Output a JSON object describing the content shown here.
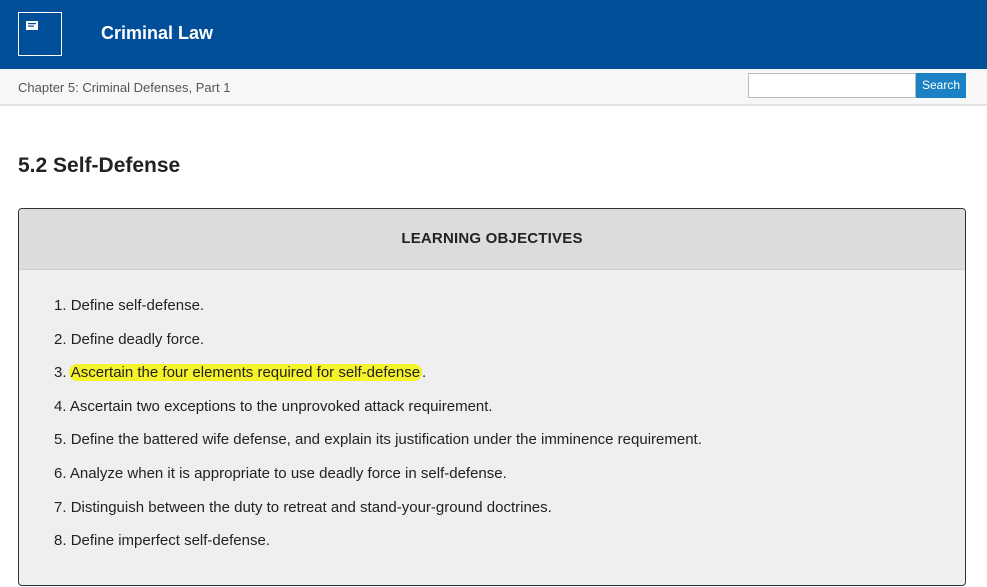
{
  "header": {
    "book_title": "Criminal Law",
    "logo_icon": "book-logo-icon",
    "background_color": "#004f98"
  },
  "subheader": {
    "chapter_title": "Chapter 5: Criminal Defenses, Part 1",
    "search": {
      "placeholder": "",
      "button_label": "Search",
      "button_color": "#1a82c4"
    }
  },
  "main": {
    "section_title": "5.2 Self-Defense",
    "objectives": {
      "heading": "LEARNING OBJECTIVES",
      "highlight_color": "#f5f32a",
      "items": [
        {
          "number": "1.",
          "text": "Define self-defense.",
          "highlighted": false
        },
        {
          "number": "2.",
          "text": "Define deadly force.",
          "highlighted": false
        },
        {
          "number": "3.",
          "text": "Ascertain the four elements required for self-defense",
          "suffix": ".",
          "highlighted": true
        },
        {
          "number": "4.",
          "text": "Ascertain two exceptions to the unprovoked attack requirement.",
          "highlighted": false
        },
        {
          "number": "5.",
          "text": "Define the battered wife defense, and explain its justification under the imminence requirement.",
          "highlighted": false
        },
        {
          "number": "6.",
          "text": "Analyze when it is appropriate to use deadly force in self-defense.",
          "highlighted": false
        },
        {
          "number": "7.",
          "text": "Distinguish between the duty to retreat and stand-your-ground doctrines.",
          "highlighted": false
        },
        {
          "number": "8.",
          "text": "Define imperfect self-defense.",
          "highlighted": false
        }
      ]
    }
  }
}
